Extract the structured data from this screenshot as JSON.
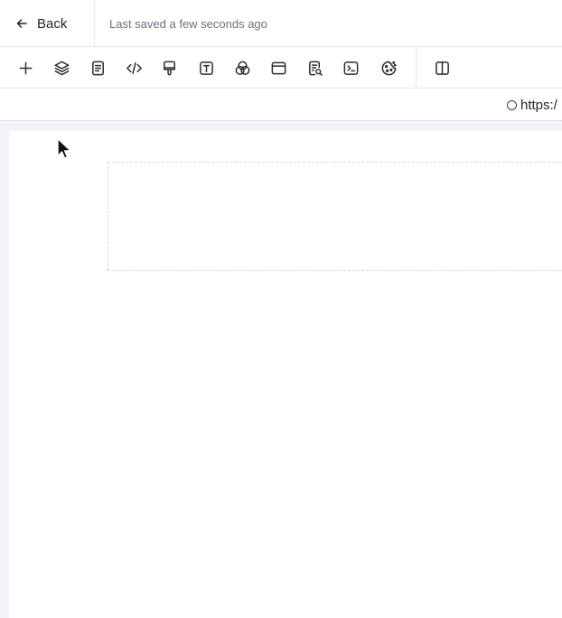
{
  "header": {
    "back_label": "Back",
    "save_status": "Last saved a few seconds ago"
  },
  "toolbar": {
    "tools": [
      {
        "icon": "plus-icon"
      },
      {
        "icon": "layers-icon"
      },
      {
        "icon": "page-icon"
      },
      {
        "icon": "code-icon"
      },
      {
        "icon": "paint-brush-icon"
      },
      {
        "icon": "text-icon"
      },
      {
        "icon": "color-circles-icon"
      },
      {
        "icon": "browser-window-icon"
      },
      {
        "icon": "page-search-icon"
      },
      {
        "icon": "terminal-icon"
      },
      {
        "icon": "cookie-icon"
      },
      {
        "icon": "split-view-icon"
      }
    ]
  },
  "urlbar": {
    "url_text": "https:/"
  }
}
